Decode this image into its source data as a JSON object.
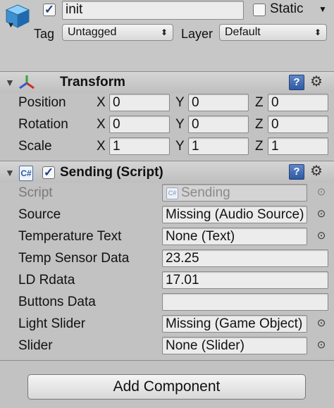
{
  "header": {
    "object_name": "init",
    "active_checked": true,
    "static_label": "Static",
    "static_checked": false,
    "tag_label": "Tag",
    "tag_value": "Untagged",
    "layer_label": "Layer",
    "layer_value": "Default"
  },
  "transform": {
    "title": "Transform",
    "rows": [
      {
        "label": "Position",
        "x": "0",
        "y": "0",
        "z": "0"
      },
      {
        "label": "Rotation",
        "x": "0",
        "y": "0",
        "z": "0"
      },
      {
        "label": "Scale",
        "x": "1",
        "y": "1",
        "z": "1"
      }
    ],
    "axes": [
      "X",
      "Y",
      "Z"
    ]
  },
  "sending": {
    "title": "Sending (Script)",
    "enabled": true,
    "fields": [
      {
        "label": "Script",
        "value": "Sending"
      },
      {
        "label": "Source",
        "value": "Missing (Audio Source)"
      },
      {
        "label": "Temperature Text",
        "value": "None (Text)"
      },
      {
        "label": "Temp Sensor Data",
        "value": "23.25"
      },
      {
        "label": "LD Rdata",
        "value": "17.01"
      },
      {
        "label": "Buttons Data",
        "value": ""
      },
      {
        "label": "Light Slider",
        "value": "Missing (Game Object)"
      },
      {
        "label": "Slider",
        "value": "None (Slider)"
      }
    ]
  },
  "footer": {
    "add_component_label": "Add Component"
  },
  "icons": {
    "object": "cube-icon",
    "transform": "transform-axes-icon",
    "script": "script-icon",
    "help": "help-icon",
    "settings": "gear-icon",
    "object_picker": "target-icon"
  }
}
